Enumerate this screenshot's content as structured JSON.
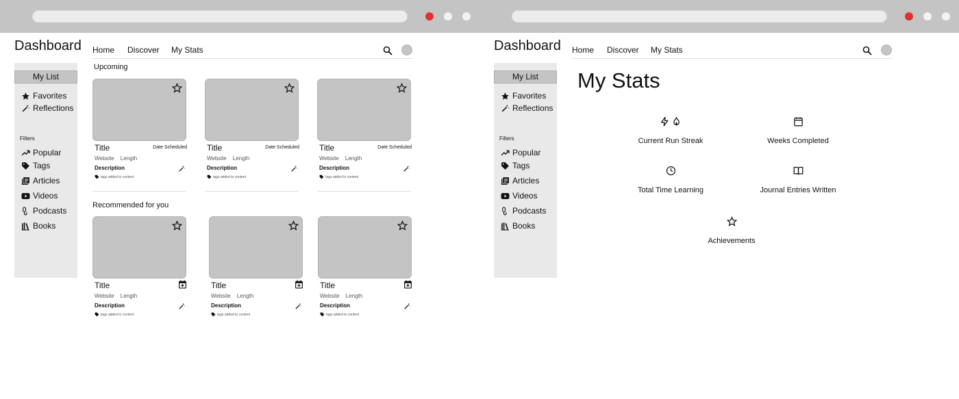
{
  "browser": {
    "buttons": [
      "close",
      "minimize",
      "maximize"
    ]
  },
  "dashboard_title": "Dashboard",
  "nav": {
    "home": "Home",
    "discover": "Discover",
    "my_stats": "My Stats"
  },
  "sidebar": {
    "my_list": "My List",
    "favorites": "Favorites",
    "reflections": "Reflections",
    "filters_label": "Filters",
    "filters": [
      "Popular",
      "Tags",
      "Articles",
      "Videos",
      "Podcasts",
      "Books"
    ]
  },
  "upcoming": {
    "heading": "Upcoming",
    "cards": [
      {
        "title": "Title",
        "date": "Date Scheduled",
        "website": "Website",
        "length": "Length",
        "description": "Description",
        "tags": "tags added to content"
      },
      {
        "title": "Title",
        "date": "Date Scheduled",
        "website": "Website",
        "length": "Length",
        "description": "Description",
        "tags": "tags added to content"
      },
      {
        "title": "Title",
        "date": "Date Scheduled",
        "website": "Website",
        "length": "Length",
        "description": "Description",
        "tags": "tags added to content"
      }
    ]
  },
  "recommended": {
    "heading": "Recommended for you",
    "cards": [
      {
        "title": "Title",
        "website": "Website",
        "length": "Length",
        "description": "Description",
        "tags": "tags added to content"
      },
      {
        "title": "Title",
        "website": "Website",
        "length": "Length",
        "description": "Description",
        "tags": "tags added to content"
      },
      {
        "title": "Title",
        "website": "Website",
        "length": "Length",
        "description": "Description",
        "tags": "tags added to content"
      }
    ]
  },
  "stats_page": {
    "title": "My Stats",
    "stats": [
      "Current Run Streak",
      "Weeks Completed",
      "Total Time Learning",
      "Journal Entries Written",
      "Achievements"
    ]
  },
  "colors": {
    "chrome": "#c4c4c4",
    "close_dot": "#e03131",
    "placeholder": "#c4c4c4",
    "sidebar": "#e9e9e9"
  }
}
